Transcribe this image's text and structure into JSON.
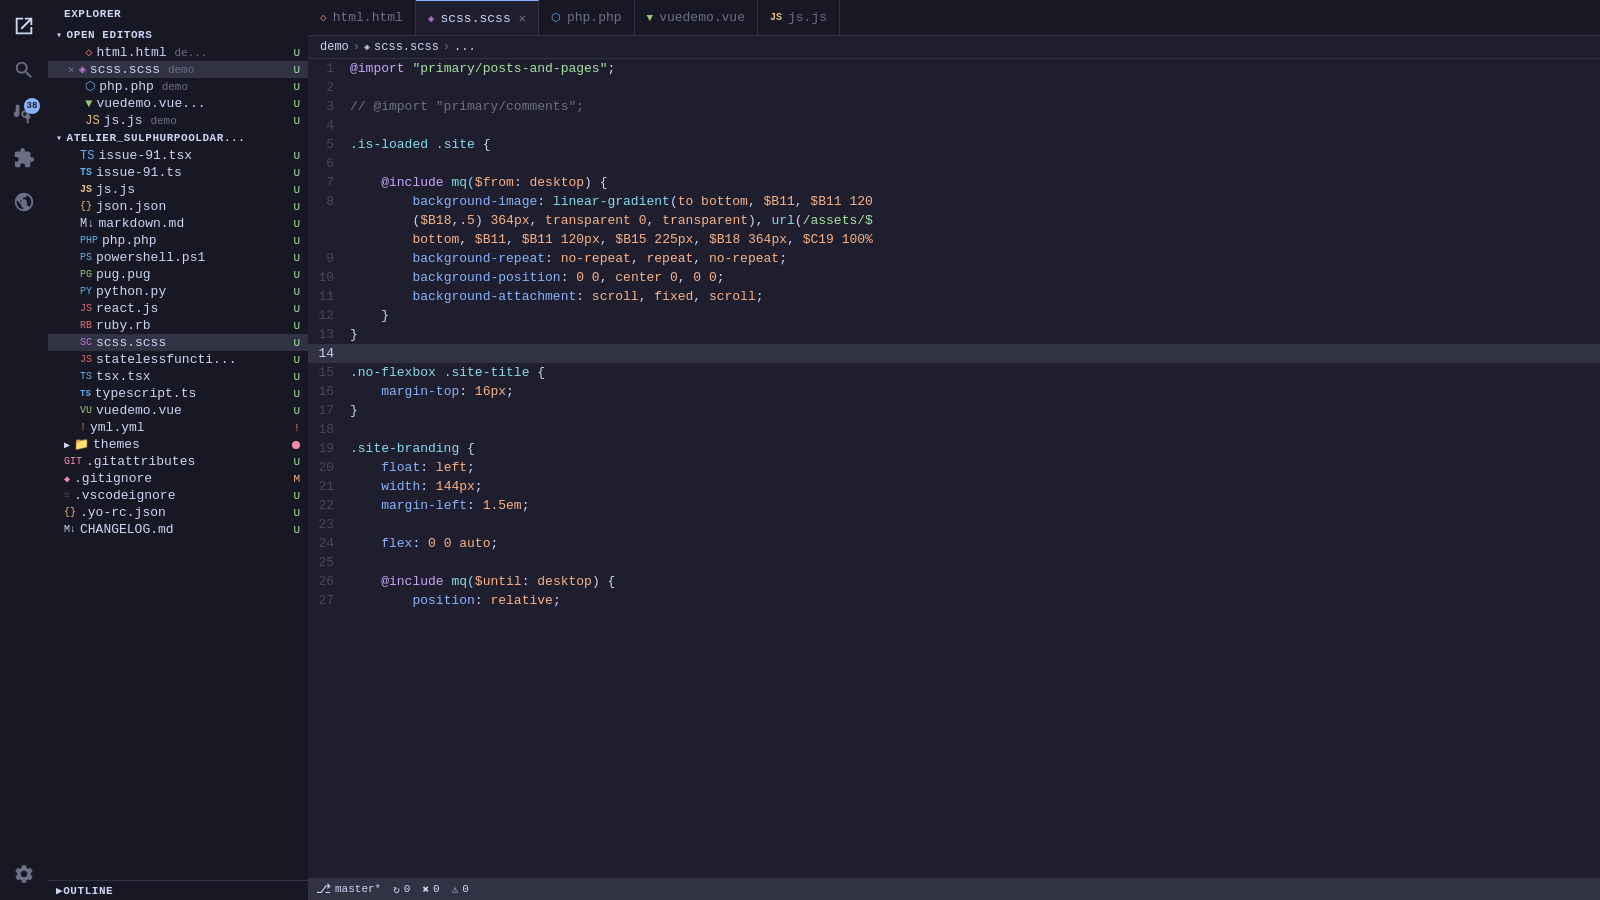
{
  "activityBar": {
    "icons": [
      {
        "name": "explorer-icon",
        "symbol": "⎘",
        "active": true,
        "badge": null
      },
      {
        "name": "search-icon",
        "symbol": "🔍",
        "active": false,
        "badge": null
      },
      {
        "name": "source-control-icon",
        "symbol": "⎇",
        "active": false,
        "badge": "38"
      },
      {
        "name": "extensions-icon",
        "symbol": "⊞",
        "active": false,
        "badge": null
      },
      {
        "name": "debug-icon",
        "symbol": "⬡",
        "active": false,
        "badge": null
      }
    ],
    "bottomIcons": [
      {
        "name": "settings-icon",
        "symbol": "⚙"
      }
    ]
  },
  "sidebar": {
    "title": "EXPLORER",
    "sections": {
      "openEditors": {
        "label": "OPEN EDITORS",
        "items": [
          {
            "name": "html.html",
            "display": "html.html",
            "path": "de...",
            "icon": "html",
            "badge": "U",
            "hasClose": false
          },
          {
            "name": "scss.scss",
            "display": "scss.scss",
            "path": "demo",
            "icon": "scss",
            "badge": "U",
            "hasClose": true,
            "active": true
          },
          {
            "name": "php.php",
            "display": "php.php",
            "path": "demo",
            "icon": "php",
            "badge": "U",
            "hasClose": false
          },
          {
            "name": "vuedemo.vue",
            "display": "vuedemo.vue...",
            "path": "",
            "icon": "vue",
            "badge": "U",
            "hasClose": false
          },
          {
            "name": "js.js",
            "display": "js.js",
            "path": "demo",
            "icon": "js",
            "badge": "U",
            "hasClose": false
          }
        ]
      },
      "project": {
        "label": "ATELIER_SULPHURPOOLDAR...",
        "items": [
          {
            "name": "issue-91.tsx",
            "display": "issue-91.tsx",
            "icon": "tsx",
            "badge": "U",
            "indent": 16
          },
          {
            "name": "issue-91.ts",
            "display": "issue-91.ts",
            "icon": "tsx",
            "badge": "U",
            "indent": 16
          },
          {
            "name": "js.js",
            "display": "js.js",
            "icon": "js",
            "badge": "U",
            "indent": 16
          },
          {
            "name": "json.json",
            "display": "json.json",
            "icon": "json",
            "badge": "U",
            "indent": 16
          },
          {
            "name": "markdown.md",
            "display": "markdown.md",
            "icon": "md",
            "badge": "U",
            "indent": 16
          },
          {
            "name": "php.php",
            "display": "php.php",
            "icon": "php",
            "badge": "U",
            "indent": 16
          },
          {
            "name": "powershell.ps1",
            "display": "powershell.ps1",
            "icon": "ps",
            "badge": "U",
            "indent": 16
          },
          {
            "name": "pug.pug",
            "display": "pug.pug",
            "icon": "pug",
            "badge": "U",
            "indent": 16
          },
          {
            "name": "python.py",
            "display": "python.py",
            "icon": "py",
            "badge": "U",
            "indent": 16
          },
          {
            "name": "react.js",
            "display": "react.js",
            "icon": "jsx",
            "badge": "U",
            "indent": 16
          },
          {
            "name": "ruby.rb",
            "display": "ruby.rb",
            "icon": "rb",
            "badge": "U",
            "indent": 16
          },
          {
            "name": "scss.scss",
            "display": "scss.scss",
            "icon": "scss",
            "badge": "U",
            "indent": 16,
            "active": true
          },
          {
            "name": "statelessfuncti",
            "display": "statelessfuncti...",
            "icon": "jsx",
            "badge": "U",
            "indent": 16
          },
          {
            "name": "tsx.tsx",
            "display": "tsx.tsx",
            "icon": "tsx",
            "badge": "U",
            "indent": 16
          },
          {
            "name": "typescript.ts",
            "display": "typescript.ts",
            "icon": "ts",
            "badge": "U",
            "indent": 16
          },
          {
            "name": "vuedemo.vue",
            "display": "vuedemo.vue",
            "icon": "vue",
            "badge": "U",
            "indent": 16
          },
          {
            "name": "yml.yml",
            "display": "yml.yml",
            "icon": "yaml",
            "badge": "!",
            "indent": 16
          },
          {
            "name": "themes-folder",
            "display": "themes",
            "icon": "folder",
            "badge": "●",
            "indent": 8,
            "isFolder": true
          },
          {
            "name": ".gitattributes",
            "display": ".gitattributes",
            "icon": "git",
            "badge": "U",
            "indent": 8
          },
          {
            "name": ".gitignore",
            "display": ".gitignore",
            "icon": "git",
            "badge": "M",
            "indent": 8
          },
          {
            "name": ".vscodeignore",
            "display": ".vscodeignore",
            "icon": "vscode",
            "badge": "U",
            "indent": 8
          },
          {
            "name": ".yo-rc.json",
            "display": ".yo-rc.json",
            "icon": "json",
            "badge": "U",
            "indent": 8
          },
          {
            "name": "CHANGELOG.md",
            "display": "CHANGELOG.md",
            "icon": "md",
            "badge": "U",
            "indent": 8
          }
        ]
      },
      "outline": {
        "label": "OUTLINE"
      }
    }
  },
  "tabs": [
    {
      "name": "html.html",
      "label": "html.html",
      "icon": "html",
      "active": false,
      "modified": false
    },
    {
      "name": "scss.scss",
      "label": "scss.scss",
      "icon": "scss",
      "active": true,
      "modified": false,
      "hasClose": true
    },
    {
      "name": "php.php",
      "label": "php.php",
      "icon": "php",
      "active": false,
      "modified": false
    },
    {
      "name": "vuedemo.vue",
      "label": "vuedemo.vue",
      "icon": "vue",
      "active": false,
      "modified": false
    },
    {
      "name": "js.js",
      "label": "js.js",
      "icon": "js",
      "active": false,
      "modified": false
    }
  ],
  "breadcrumb": {
    "parts": [
      "demo",
      "scss.scss",
      "..."
    ]
  },
  "codeLines": [
    {
      "num": 1,
      "tokens": [
        {
          "text": "@import",
          "class": "kw-include"
        },
        {
          "text": " ",
          "class": ""
        },
        {
          "text": "\"primary/posts-and-pages\"",
          "class": "kw-string"
        },
        {
          "text": ";",
          "class": "kw-punct"
        }
      ]
    },
    {
      "num": 2,
      "tokens": []
    },
    {
      "num": 3,
      "tokens": [
        {
          "text": "// @import \"primary/comments\";",
          "class": "kw-comment"
        }
      ]
    },
    {
      "num": 4,
      "tokens": []
    },
    {
      "num": 5,
      "tokens": [
        {
          "text": ".is-loaded",
          "class": "kw-selector"
        },
        {
          "text": " ",
          "class": ""
        },
        {
          "text": ".site",
          "class": "kw-selector"
        },
        {
          "text": " {",
          "class": "kw-punct"
        }
      ]
    },
    {
      "num": 6,
      "tokens": []
    },
    {
      "num": 7,
      "tokens": [
        {
          "text": "    ",
          "class": ""
        },
        {
          "text": "@include",
          "class": "kw-include"
        },
        {
          "text": " mq(",
          "class": "kw-func"
        },
        {
          "text": "$from",
          "class": "kw-var"
        },
        {
          "text": ":",
          "class": "kw-punct"
        },
        {
          "text": " desktop",
          "class": "kw-value"
        },
        {
          "text": ") {",
          "class": "kw-punct"
        }
      ]
    },
    {
      "num": 8,
      "tokens": [
        {
          "text": "        background-image: linear-gradient(to bottom, $B11, $B11 120",
          "class": "kw-property kw-value"
        },
        {
          "text": "...",
          "class": "kw-punct"
        }
      ]
    },
    {
      "num": 8,
      "tokens": [
        {
          "text": "        ($B18,.5) 364px, transparent 0, transparent), url(/assets/$",
          "class": "kw-value"
        },
        {
          "text": "...",
          "class": "kw-punct"
        }
      ]
    },
    {
      "num": 8,
      "tokens": [
        {
          "text": "        bottom, $B11, $B11 120px, $B15 225px, $B18 364px, $C19 100%",
          "class": "kw-value"
        },
        {
          "text": "...",
          "class": "kw-punct"
        }
      ]
    },
    {
      "num": 9,
      "tokens": [
        {
          "text": "        ",
          "class": ""
        },
        {
          "text": "background-repeat",
          "class": "kw-property"
        },
        {
          "text": ": ",
          "class": "kw-punct"
        },
        {
          "text": "no-repeat",
          "class": "kw-value"
        },
        {
          "text": ", ",
          "class": "kw-punct"
        },
        {
          "text": "repeat",
          "class": "kw-value"
        },
        {
          "text": ", ",
          "class": "kw-punct"
        },
        {
          "text": "no-repeat",
          "class": "kw-value"
        },
        {
          "text": ";",
          "class": "kw-punct"
        }
      ]
    },
    {
      "num": 10,
      "tokens": [
        {
          "text": "        ",
          "class": ""
        },
        {
          "text": "background-position",
          "class": "kw-property"
        },
        {
          "text": ": ",
          "class": "kw-punct"
        },
        {
          "text": "0 0",
          "class": "kw-value"
        },
        {
          "text": ", ",
          "class": "kw-punct"
        },
        {
          "text": "center 0",
          "class": "kw-value"
        },
        {
          "text": ", ",
          "class": "kw-punct"
        },
        {
          "text": "0 0",
          "class": "kw-value"
        },
        {
          "text": ";",
          "class": "kw-punct"
        }
      ]
    },
    {
      "num": 11,
      "tokens": [
        {
          "text": "        ",
          "class": ""
        },
        {
          "text": "background-attachment",
          "class": "kw-property"
        },
        {
          "text": ": ",
          "class": "kw-punct"
        },
        {
          "text": "scroll",
          "class": "kw-value"
        },
        {
          "text": ", ",
          "class": "kw-punct"
        },
        {
          "text": "fixed",
          "class": "kw-value"
        },
        {
          "text": ", ",
          "class": "kw-punct"
        },
        {
          "text": "scroll",
          "class": "kw-value"
        },
        {
          "text": ";",
          "class": "kw-punct"
        }
      ]
    },
    {
      "num": 12,
      "tokens": [
        {
          "text": "    }",
          "class": "kw-punct"
        }
      ]
    },
    {
      "num": 13,
      "tokens": [
        {
          "text": "}",
          "class": "kw-punct"
        }
      ]
    },
    {
      "num": 14,
      "tokens": [],
      "current": true
    },
    {
      "num": 15,
      "tokens": [
        {
          "text": ".no-flexbox",
          "class": "kw-selector"
        },
        {
          "text": " ",
          "class": ""
        },
        {
          "text": ".site-title",
          "class": "kw-selector"
        },
        {
          "text": " {",
          "class": "kw-punct"
        }
      ]
    },
    {
      "num": 16,
      "tokens": [
        {
          "text": "    ",
          "class": ""
        },
        {
          "text": "margin-top",
          "class": "kw-property"
        },
        {
          "text": ": ",
          "class": "kw-punct"
        },
        {
          "text": "16",
          "class": "kw-number"
        },
        {
          "text": "px",
          "class": "kw-value"
        },
        {
          "text": ";",
          "class": "kw-punct"
        }
      ]
    },
    {
      "num": 17,
      "tokens": [
        {
          "text": "}",
          "class": "kw-punct"
        }
      ]
    },
    {
      "num": 18,
      "tokens": []
    },
    {
      "num": 19,
      "tokens": [
        {
          "text": ".site-branding",
          "class": "kw-selector"
        },
        {
          "text": " {",
          "class": "kw-punct"
        }
      ]
    },
    {
      "num": 20,
      "tokens": [
        {
          "text": "    ",
          "class": ""
        },
        {
          "text": "float",
          "class": "kw-property"
        },
        {
          "text": ": ",
          "class": "kw-punct"
        },
        {
          "text": "left",
          "class": "kw-value"
        },
        {
          "text": ";",
          "class": "kw-punct"
        }
      ]
    },
    {
      "num": 21,
      "tokens": [
        {
          "text": "    ",
          "class": ""
        },
        {
          "text": "width",
          "class": "kw-property"
        },
        {
          "text": ": ",
          "class": "kw-punct"
        },
        {
          "text": "144",
          "class": "kw-number"
        },
        {
          "text": "px",
          "class": "kw-value"
        },
        {
          "text": ";",
          "class": "kw-punct"
        }
      ]
    },
    {
      "num": 22,
      "tokens": [
        {
          "text": "    ",
          "class": ""
        },
        {
          "text": "margin-left",
          "class": "kw-property"
        },
        {
          "text": ": ",
          "class": "kw-punct"
        },
        {
          "text": "1.5",
          "class": "kw-number"
        },
        {
          "text": "em",
          "class": "kw-value"
        },
        {
          "text": ";",
          "class": "kw-punct"
        }
      ]
    },
    {
      "num": 23,
      "tokens": []
    },
    {
      "num": 24,
      "tokens": [
        {
          "text": "    ",
          "class": ""
        },
        {
          "text": "flex",
          "class": "kw-property"
        },
        {
          "text": ": ",
          "class": "kw-punct"
        },
        {
          "text": "0 0 auto",
          "class": "kw-value"
        },
        {
          "text": ";",
          "class": "kw-punct"
        }
      ]
    },
    {
      "num": 25,
      "tokens": []
    },
    {
      "num": 26,
      "tokens": [
        {
          "text": "    ",
          "class": ""
        },
        {
          "text": "@include",
          "class": "kw-include"
        },
        {
          "text": " mq(",
          "class": "kw-func"
        },
        {
          "text": "$until",
          "class": "kw-var"
        },
        {
          "text": ":",
          "class": "kw-punct"
        },
        {
          "text": " desktop",
          "class": "kw-value"
        },
        {
          "text": ") {",
          "class": "kw-punct"
        }
      ]
    },
    {
      "num": 27,
      "tokens": [
        {
          "text": "        ",
          "class": ""
        },
        {
          "text": "position",
          "class": "kw-property"
        },
        {
          "text": ": ",
          "class": "kw-punct"
        },
        {
          "text": "relative",
          "class": "kw-value"
        },
        {
          "text": ";",
          "class": "kw-punct"
        }
      ]
    }
  ],
  "statusBar": {
    "branch": "master*",
    "sync": "↻ 0",
    "warnings": "⚠ 0",
    "errors": "✖ 0"
  }
}
